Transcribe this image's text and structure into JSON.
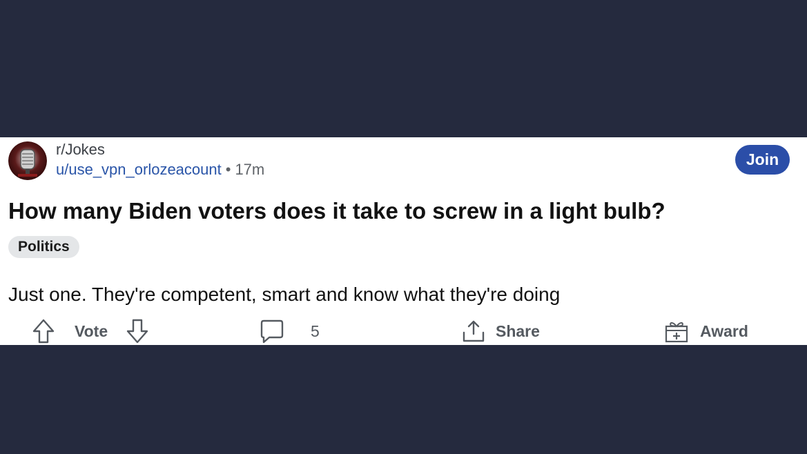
{
  "post": {
    "subreddit": "r/Jokes",
    "username": "u/use_vpn_orlozeacount",
    "separator": "•",
    "age": "17m",
    "join_label": "Join",
    "title": "How many Biden voters does it take to screw in a light bulb?",
    "flair": "Politics",
    "body": "Just one. They're competent, smart and know what they're doing"
  },
  "actions": {
    "vote_label": "Vote",
    "comment_count": "5",
    "share_label": "Share",
    "award_label": "Award"
  },
  "icons": {
    "avatar": "subreddit-avatar-icon",
    "upvote": "upvote-arrow-icon",
    "downvote": "downvote-arrow-icon",
    "comment": "comment-bubble-icon",
    "share": "share-icon",
    "award": "award-gift-icon"
  },
  "colors": {
    "page_background": "#252a3e",
    "card_background": "#ffffff",
    "join_button": "#2b4ea8",
    "username_link": "#2a55a8",
    "flair_background": "#e4e6e8",
    "action_text": "#555a60"
  }
}
